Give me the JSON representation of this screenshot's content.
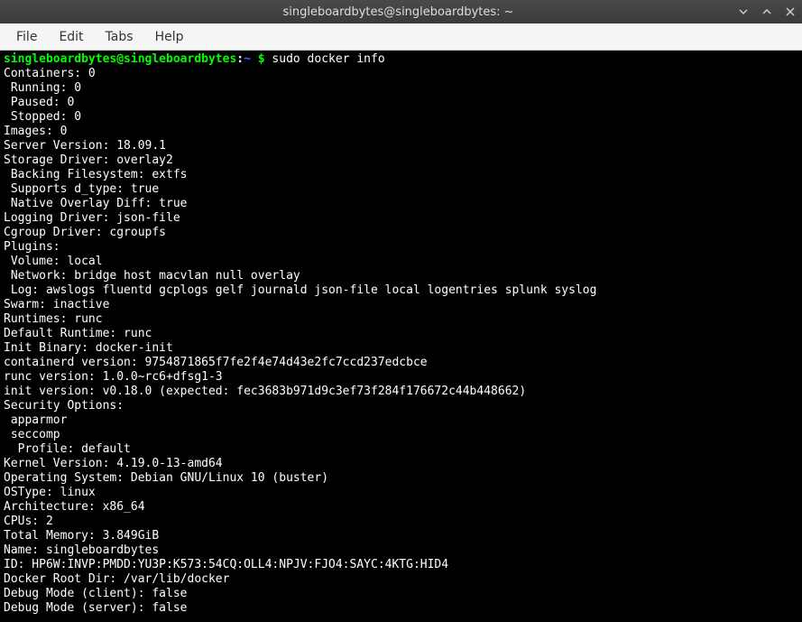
{
  "window": {
    "title": "singleboardbytes@singleboardbytes: ~"
  },
  "menubar": {
    "file": "File",
    "edit": "Edit",
    "tabs": "Tabs",
    "help": "Help"
  },
  "prompt": {
    "userhost": "singleboardbytes@singleboardbytes",
    "sep1": ":",
    "path": "~",
    "dollar": " $ "
  },
  "command": "sudo docker info",
  "output": [
    "Containers: 0",
    " Running: 0",
    " Paused: 0",
    " Stopped: 0",
    "Images: 0",
    "Server Version: 18.09.1",
    "Storage Driver: overlay2",
    " Backing Filesystem: extfs",
    " Supports d_type: true",
    " Native Overlay Diff: true",
    "Logging Driver: json-file",
    "Cgroup Driver: cgroupfs",
    "Plugins:",
    " Volume: local",
    " Network: bridge host macvlan null overlay",
    " Log: awslogs fluentd gcplogs gelf journald json-file local logentries splunk syslog",
    "Swarm: inactive",
    "Runtimes: runc",
    "Default Runtime: runc",
    "Init Binary: docker-init",
    "containerd version: 9754871865f7fe2f4e74d43e2fc7ccd237edcbce",
    "runc version: 1.0.0~rc6+dfsg1-3",
    "init version: v0.18.0 (expected: fec3683b971d9c3ef73f284f176672c44b448662)",
    "Security Options:",
    " apparmor",
    " seccomp",
    "  Profile: default",
    "Kernel Version: 4.19.0-13-amd64",
    "Operating System: Debian GNU/Linux 10 (buster)",
    "OSType: linux",
    "Architecture: x86_64",
    "CPUs: 2",
    "Total Memory: 3.849GiB",
    "Name: singleboardbytes",
    "ID: HP6W:INVP:PMDD:YU3P:K573:54CQ:OLL4:NPJV:FJO4:SAYC:4KTG:HID4",
    "Docker Root Dir: /var/lib/docker",
    "Debug Mode (client): false",
    "Debug Mode (server): false"
  ]
}
